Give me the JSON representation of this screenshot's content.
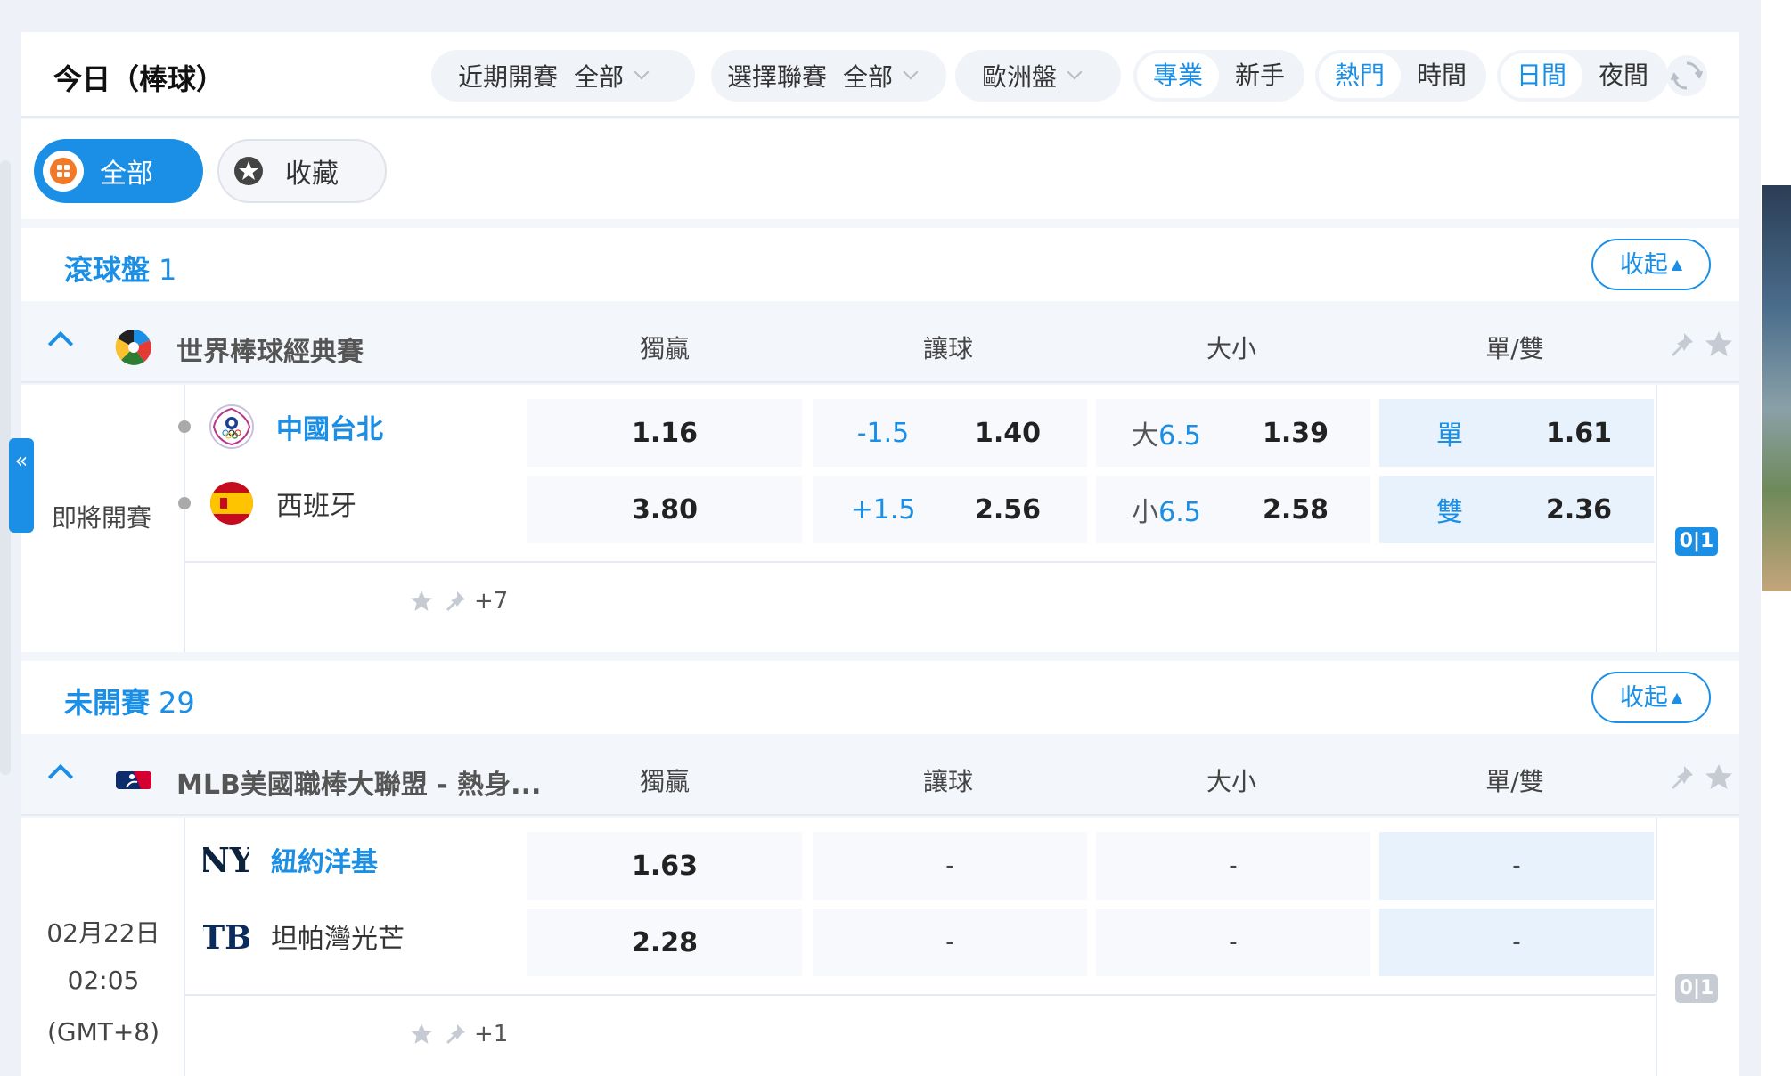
{
  "header": {
    "title": "今日（棒球）",
    "recent_label": "近期開賽",
    "recent_value": "全部",
    "league_label": "選擇聯賽",
    "league_value": "全部",
    "odds_format": "歐洲盤",
    "mode_options": [
      "專業",
      "新手"
    ],
    "sort_options": [
      "熱門",
      "時間"
    ],
    "theme_options": [
      "日間",
      "夜間"
    ]
  },
  "filters": {
    "all": "全部",
    "favorites": "收藏"
  },
  "sections": [
    {
      "title": "滾球盤",
      "count": "1",
      "collapse": "收起"
    },
    {
      "title": "未開賽",
      "count": "29",
      "collapse": "收起"
    }
  ],
  "columns": [
    "獨贏",
    "讓球",
    "大小",
    "單/雙"
  ],
  "leagues": [
    {
      "name": "世界棒球經典賽",
      "status": "即將開賽",
      "more": "+7",
      "teams": [
        {
          "name": "中國台北",
          "moneyline": "1.16",
          "handicap": "-1.5",
          "handicap_odds": "1.40",
          "ou_label": "大",
          "ou_line": "6.5",
          "ou_odds": "1.39",
          "oe_label": "單",
          "oe_odds": "1.61"
        },
        {
          "name": "西班牙",
          "moneyline": "3.80",
          "handicap": "+1.5",
          "handicap_odds": "2.56",
          "ou_label": "小",
          "ou_line": "6.5",
          "ou_odds": "2.58",
          "oe_label": "雙",
          "oe_odds": "2.36"
        }
      ]
    },
    {
      "name": "MLB美國職棒大聯盟 - 熱身...",
      "date": "02月22日",
      "time": "02:05",
      "tz": "(GMT+8)",
      "more": "+1",
      "teams": [
        {
          "name": "紐約洋基",
          "moneyline": "1.63",
          "handicap": "-",
          "ou": "-",
          "oe": "-"
        },
        {
          "name": "坦帕灣光芒",
          "moneyline": "2.28",
          "handicap": "-",
          "ou": "-",
          "oe": "-"
        }
      ]
    }
  ],
  "side_tab": "«",
  "score_badge": "0|1",
  "colors": {
    "accent": "#1b8fe6",
    "orange": "#f07a2a",
    "panel": "#f3f6fb"
  }
}
